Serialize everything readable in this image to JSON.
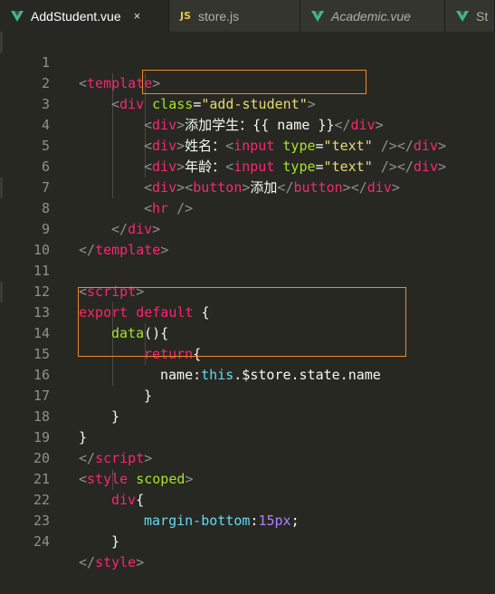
{
  "tabs": [
    {
      "label": "AddStudent.vue",
      "icon": "vue-icon",
      "active": true,
      "close": "×"
    },
    {
      "label": "store.js",
      "icon": "js-icon",
      "icon_text": "JS",
      "active": false
    },
    {
      "label": "Academic.vue",
      "icon": "vue-icon",
      "active": false,
      "italic": true
    },
    {
      "label": "St",
      "icon": "vue-icon",
      "active": false
    }
  ],
  "lines": [
    {
      "n": "1"
    },
    {
      "n": "2"
    },
    {
      "n": "3"
    },
    {
      "n": "4"
    },
    {
      "n": "5"
    },
    {
      "n": "6"
    },
    {
      "n": "7"
    },
    {
      "n": "8"
    },
    {
      "n": "9"
    },
    {
      "n": "10"
    },
    {
      "n": "11"
    },
    {
      "n": "12"
    },
    {
      "n": "13"
    },
    {
      "n": "14"
    },
    {
      "n": "15"
    },
    {
      "n": "16"
    },
    {
      "n": "17"
    },
    {
      "n": "18"
    },
    {
      "n": "19"
    },
    {
      "n": "20"
    },
    {
      "n": "21"
    },
    {
      "n": "22"
    },
    {
      "n": "23"
    },
    {
      "n": "24"
    }
  ],
  "code": {
    "l1": {
      "open": "<",
      "tag": "template",
      "close": ">"
    },
    "l2": {
      "open": "<",
      "tag": "div",
      "attr": "class",
      "eq": "=",
      "val": "\"add-student\"",
      "close": ">"
    },
    "l3": {
      "open": "<",
      "tag": "div",
      "close": ">",
      "text": "添加学生：{{ name }}",
      "endopen": "</",
      "endtag": "div",
      "endclose": ">"
    },
    "l4": {
      "open": "<",
      "tag": "div",
      "close": ">",
      "text": "姓名：",
      "iopen": "<",
      "itag": "input",
      "attr": "type",
      "eq": "=",
      "val": "\"text\"",
      "iclose": " />",
      "endopen": "</",
      "endtag": "div",
      "endclose": ">"
    },
    "l5": {
      "open": "<",
      "tag": "div",
      "close": ">",
      "text": "年龄：",
      "iopen": "<",
      "itag": "input",
      "attr": "type",
      "eq": "=",
      "val": "\"text\"",
      "iclose": " />",
      "endopen": "</",
      "endtag": "div",
      "endclose": ">"
    },
    "l6": {
      "open": "<",
      "tag": "div",
      "close": ">",
      "bopen": "<",
      "btag": "button",
      "bclose": ">",
      "text": "添加",
      "beopen": "</",
      "betag": "button",
      "beclose": ">",
      "endopen": "</",
      "endtag": "div",
      "endclose": ">"
    },
    "l7": {
      "open": "<",
      "tag": "hr",
      "close": " />"
    },
    "l8": {
      "open": "</",
      "tag": "div",
      "close": ">"
    },
    "l9": {
      "open": "</",
      "tag": "template",
      "close": ">"
    },
    "l11": {
      "open": "<",
      "tag": "script",
      "close": ">"
    },
    "l12": {
      "kw1": "export",
      "kw2": "default",
      "brace": " {"
    },
    "l13": {
      "fn": "data",
      "rest": "(){"
    },
    "l14": {
      "kw": "return",
      "rest": "{"
    },
    "l15": {
      "prop": "name",
      "colon": ":",
      "kw": "this",
      "rest": ".$store.state.name"
    },
    "l16": {
      "rest": "}"
    },
    "l17": {
      "rest": "}"
    },
    "l18": {
      "rest": "}"
    },
    "l19": {
      "open": "</",
      "tag": "script",
      "close": ">"
    },
    "l20": {
      "open": "<",
      "tag": "style",
      "attr": "scoped",
      "close": ">"
    },
    "l21": {
      "sel": "div",
      "rest": "{"
    },
    "l22": {
      "prop": "margin-bottom",
      "colon": ":",
      "num": "15px",
      "semi": ";"
    },
    "l23": {
      "rest": "}"
    },
    "l24": {
      "open": "</",
      "tag": "style",
      "close": ">"
    }
  },
  "colors": {
    "background": "#272822",
    "highlight_box": "#f0882a",
    "tag": "#f92672",
    "string": "#e6db74",
    "attribute": "#a6e22e"
  }
}
